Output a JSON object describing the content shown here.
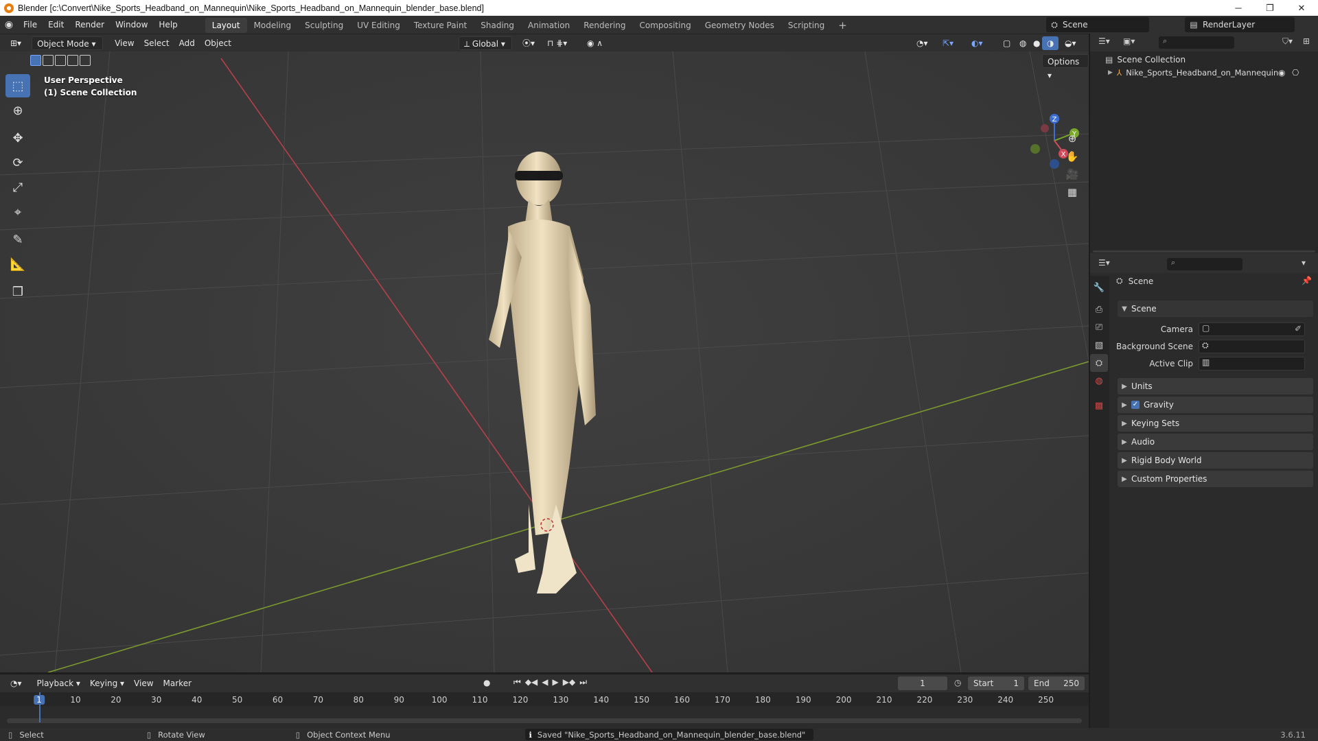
{
  "window": {
    "title": "Blender [c:\\Convert\\Nike_Sports_Headband_on_Mannequin\\Nike_Sports_Headband_on_Mannequin_blender_base.blend]",
    "min": "─",
    "max": "❐",
    "close": "✕"
  },
  "menus": [
    "File",
    "Edit",
    "Render",
    "Window",
    "Help"
  ],
  "workspaces": [
    "Layout",
    "Modeling",
    "Sculpting",
    "UV Editing",
    "Texture Paint",
    "Shading",
    "Animation",
    "Rendering",
    "Compositing",
    "Geometry Nodes",
    "Scripting"
  ],
  "workspace_add": "+",
  "scene_selector": {
    "label": "Scene"
  },
  "renderlayer_selector": {
    "label": "RenderLayer"
  },
  "viewport_header": {
    "mode": "Object Mode",
    "menus": [
      "View",
      "Select",
      "Add",
      "Object"
    ],
    "transform_orientation": "Global",
    "options": "Options"
  },
  "viewport": {
    "line1": "User Perspective",
    "line2": "(1) Scene Collection",
    "gizmo": {
      "x": "X",
      "y": "Y",
      "z": "Z"
    }
  },
  "outliner": {
    "root": "Scene Collection",
    "items": [
      {
        "label": "Nike_Sports_Headband_on_Mannequin"
      }
    ]
  },
  "properties": {
    "header": "Scene",
    "section": "Scene",
    "fields": [
      {
        "label": "Camera",
        "value": ""
      },
      {
        "label": "Background Scene",
        "value": ""
      },
      {
        "label": "Active Clip",
        "value": ""
      }
    ],
    "panels": [
      "Units",
      "Gravity",
      "Keying Sets",
      "Audio",
      "Rigid Body World",
      "Custom Properties"
    ],
    "gravity_checked": true
  },
  "timeline": {
    "menus": [
      "Playback",
      "Keying",
      "View",
      "Marker"
    ],
    "current_frame": "1",
    "start_label": "Start",
    "start": "1",
    "end_label": "End",
    "end": "250",
    "ticks": [
      "1",
      "10",
      "20",
      "30",
      "40",
      "50",
      "60",
      "70",
      "80",
      "90",
      "100",
      "110",
      "120",
      "130",
      "140",
      "150",
      "160",
      "170",
      "180",
      "190",
      "200",
      "210",
      "220",
      "230",
      "240",
      "250"
    ]
  },
  "statusbar": {
    "select": "Select",
    "rotate": "Rotate View",
    "context": "Object Context Menu",
    "message": "Saved \"Nike_Sports_Headband_on_Mannequin_blender_base.blend\"",
    "version": "3.6.11"
  }
}
